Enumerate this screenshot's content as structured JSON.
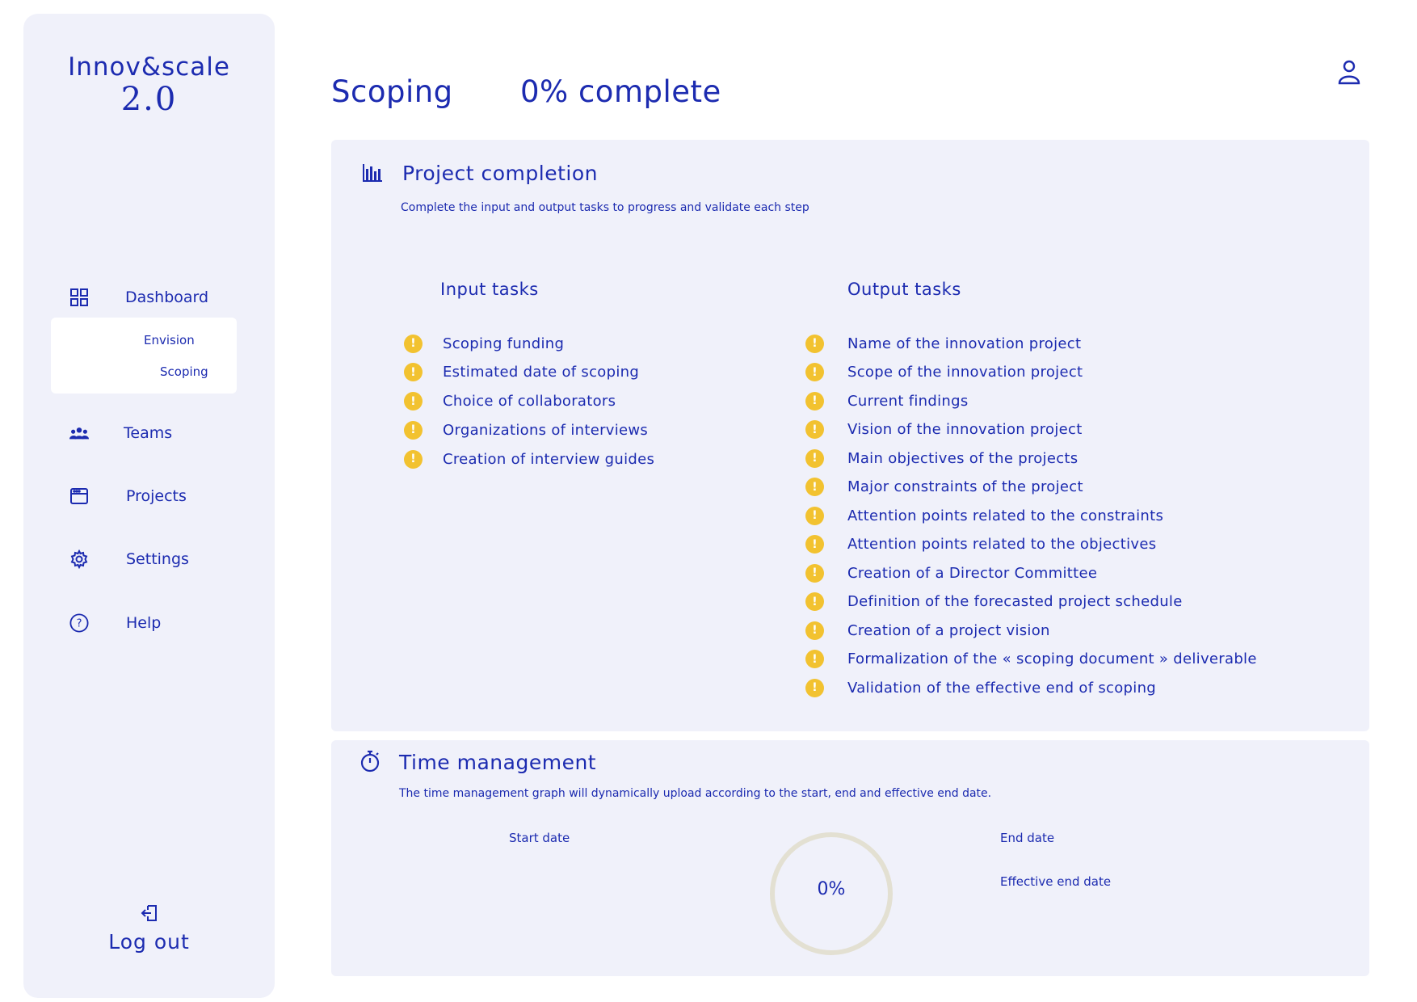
{
  "app": {
    "logo_line1": "Innov&scale",
    "logo_line2": "2.0"
  },
  "sidebar": {
    "items": [
      {
        "label": "Dashboard",
        "icon": "grid-icon"
      },
      {
        "label": "Teams",
        "icon": "users-icon"
      },
      {
        "label": "Projects",
        "icon": "browser-window-icon"
      },
      {
        "label": "Settings",
        "icon": "gear-icon"
      },
      {
        "label": "Help",
        "icon": "question-circle-icon"
      }
    ],
    "submenu": [
      "Envision",
      "Scoping"
    ],
    "logout_label": "Log out"
  },
  "header": {
    "title": "Scoping",
    "progress": "0% complete"
  },
  "completion": {
    "title": "Project completion",
    "subtitle": "Complete the input and output tasks to progress and validate each step",
    "input_title": "Input tasks",
    "output_title": "Output tasks",
    "input_tasks": [
      "Scoping funding",
      "Estimated date of scoping",
      "Choice of collaborators",
      "Organizations of interviews",
      "Creation of interview guides"
    ],
    "output_tasks": [
      "Name of the innovation project",
      "Scope of the innovation project",
      "Current findings",
      "Vision of the innovation project",
      "Main objectives of the projects",
      "Major constraints of the project",
      "Attention points related to the constraints",
      "Attention points related to the objectives",
      "Creation of a Director Committee",
      "Definition of the forecasted project schedule",
      "Creation of a project vision",
      "Formalization of the « scoping document » deliverable",
      "Validation of the effective end of scoping"
    ],
    "status_mark": "!"
  },
  "time": {
    "title": "Time management",
    "subtitle": "The time management graph will dynamically upload according to the start, end and effective end date.",
    "start_label": "Start date",
    "end_label": "End date",
    "effective_end_label": "Effective end date",
    "progress_label": "0%",
    "progress_value": 0
  },
  "colors": {
    "accent": "#1c2bb0",
    "panel": "#f0f1fa",
    "warning": "#f2c230",
    "ring": "#e3e0d2"
  }
}
